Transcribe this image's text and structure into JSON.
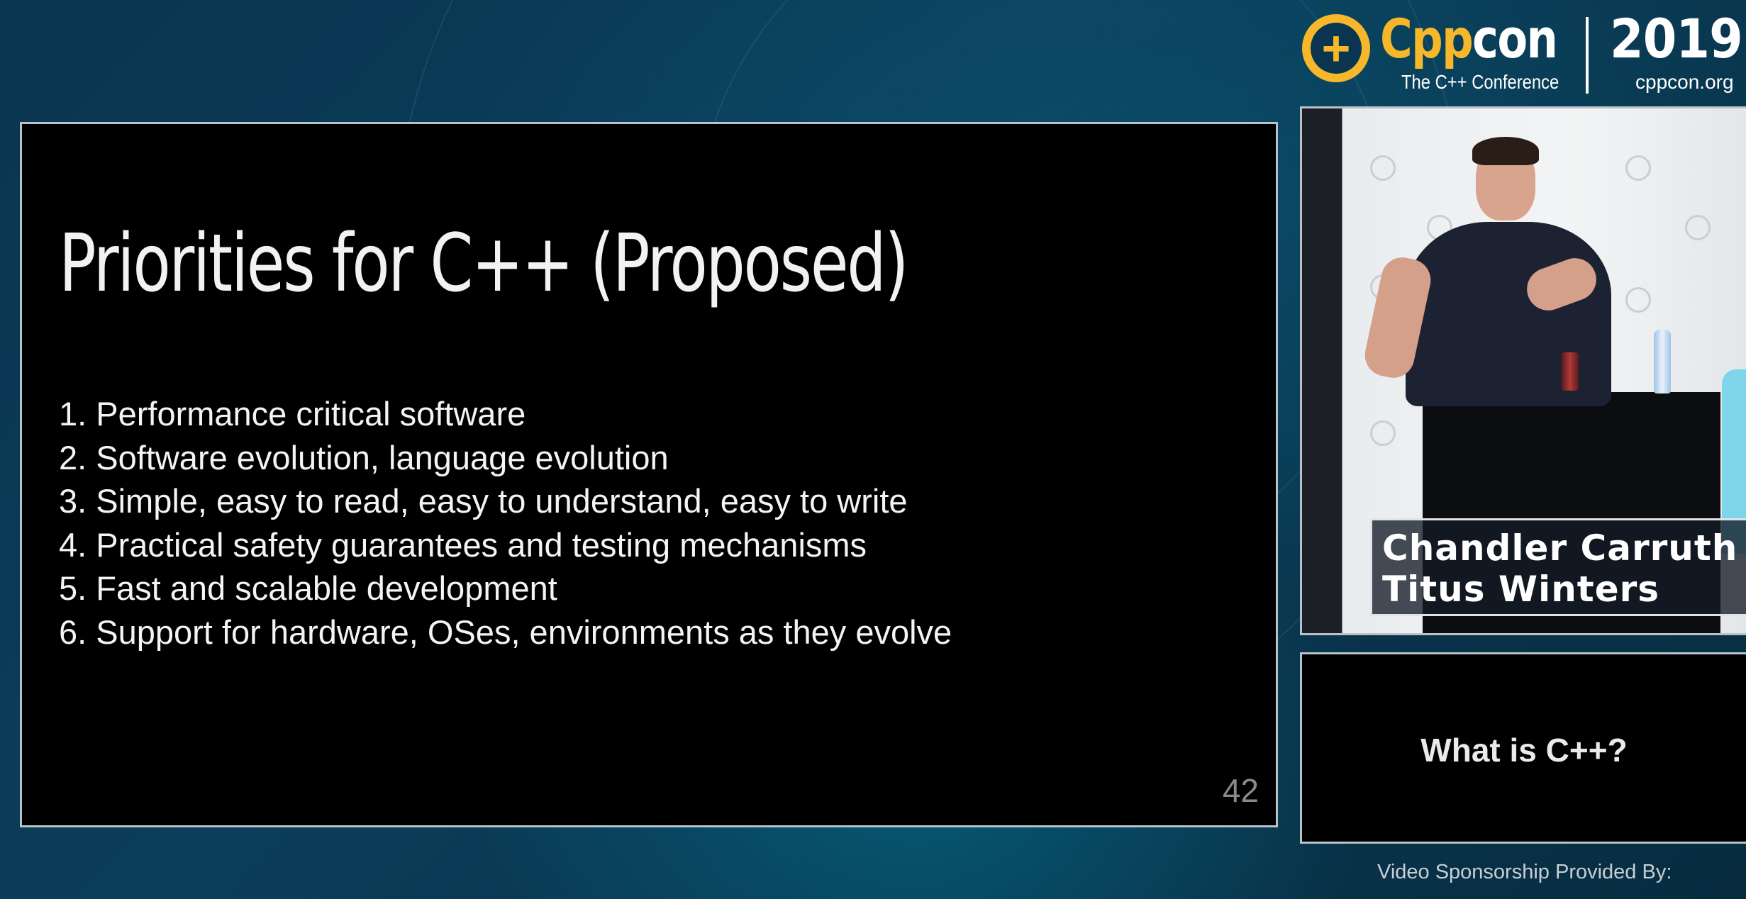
{
  "header": {
    "brand_cpp": "Cpp",
    "brand_con": "con",
    "tagline": "The C++ Conference",
    "year": "2019",
    "site": "cppcon.org",
    "logo_icon": "cppcon-plus-logo-icon"
  },
  "slide": {
    "title": "Priorities for C++ (Proposed)",
    "items": [
      "1. Performance critical software",
      "2. Software evolution, language evolution",
      "3. Simple, easy to read, easy to understand, easy to write",
      "4. Practical safety guarantees and testing mechanisms",
      "5. Fast and scalable development",
      "6. Support for hardware, OSes, environments as they evolve"
    ],
    "page_number": "42"
  },
  "video": {
    "speakers": [
      "Chandler Carruth",
      "Titus Winters"
    ]
  },
  "talk": {
    "title": "What is C++?"
  },
  "footer": {
    "sponsor_text": "Video Sponsorship Provided By:"
  },
  "colors": {
    "brand_yellow": "#f6b82a",
    "background": "#0a3550",
    "slide_background": "#000000"
  }
}
